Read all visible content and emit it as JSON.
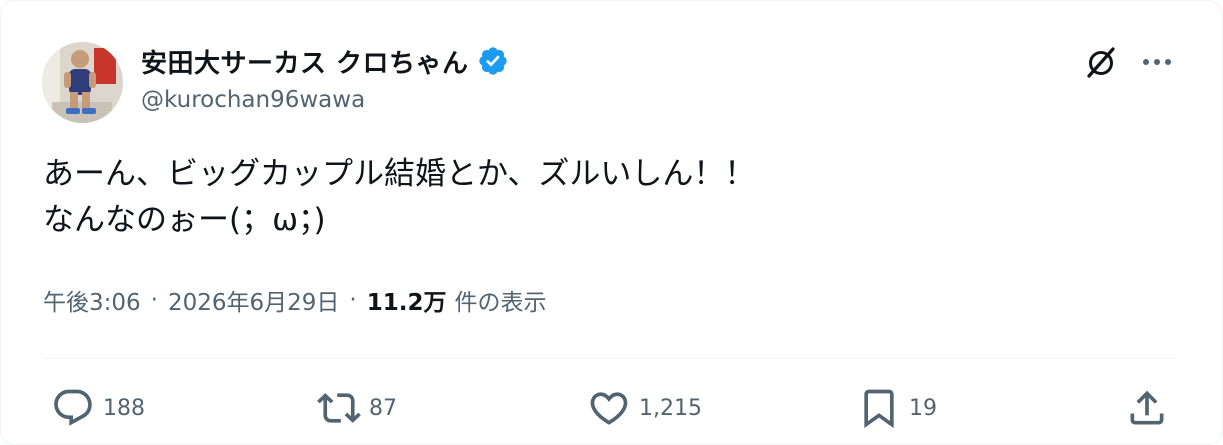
{
  "author": {
    "display_name": "安田大サーカス クロちゃん",
    "handle": "@kurochan96wawa",
    "verified": true,
    "verified_color": "#1d9bf0"
  },
  "header_actions": {
    "grok_icon": "grok-icon",
    "more_icon": "more-icon"
  },
  "tweet": {
    "lines": [
      "あーん、ビッグカップル結婚とか、ズルいしん！！",
      "なんなのぉー(；ω；)"
    ]
  },
  "meta": {
    "time": "午後3:06",
    "separator": "·",
    "date": "2026年6月29日",
    "views_count": "11.2万",
    "views_label": "件の表示"
  },
  "actions": {
    "reply": {
      "icon": "reply-icon",
      "count": "188"
    },
    "retweet": {
      "icon": "retweet-icon",
      "count": "87"
    },
    "like": {
      "icon": "heart-icon",
      "count": "1,215"
    },
    "bookmark": {
      "icon": "bookmark-icon",
      "count": "19"
    },
    "share": {
      "icon": "share-icon"
    }
  },
  "colors": {
    "text_primary": "#0f1419",
    "text_secondary": "#536471",
    "divider": "#eff3f4"
  }
}
